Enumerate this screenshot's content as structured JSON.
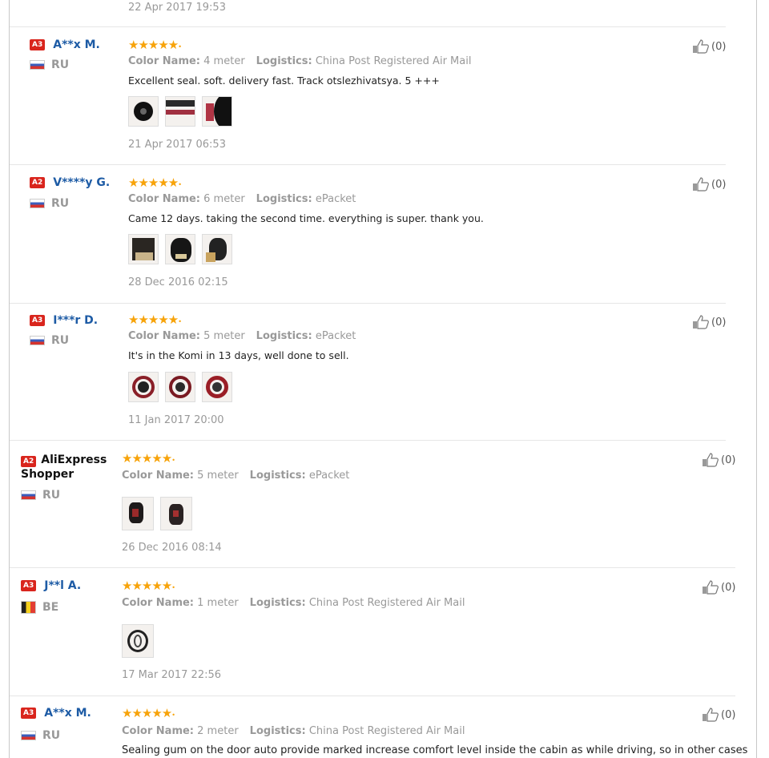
{
  "colors": {
    "username": "#1d5ba5",
    "level_badge": "#d9251d",
    "stars": "#f7a30a"
  },
  "labels": {
    "color_name": "Color Name:",
    "logistics": "Logistics:"
  },
  "top_date": "22 Apr 2017 19:53",
  "reviews": [
    {
      "level": "A3",
      "user": "A**x M.",
      "country": "RU",
      "flag": "ru",
      "stars": "★★★★★",
      "color_name": "4 meter",
      "logistics": "China Post Registered Air Mail",
      "text": "Excellent seal. soft. delivery fast. Track otslezhivatsya. 5 +++",
      "date": "21 Apr 2017 06:53",
      "helpful": "(0)",
      "photos": 3
    },
    {
      "level": "A2",
      "user": "V****y G.",
      "country": "RU",
      "flag": "ru",
      "stars": "★★★★★",
      "color_name": "6 meter",
      "logistics": "ePacket",
      "text": "Came 12 days. taking the second time. everything is super. thank you.",
      "date": "28 Dec 2016 02:15",
      "helpful": "(0)",
      "photos": 3
    },
    {
      "level": "A3",
      "user": "I***r D.",
      "country": "RU",
      "flag": "ru",
      "stars": "★★★★★",
      "color_name": "5 meter",
      "logistics": "ePacket",
      "text": "It's in the Komi in 13 days, well done to sell.",
      "date": "11 Jan 2017 20:00",
      "helpful": "(0)",
      "photos": 3
    },
    {
      "level": "A2",
      "user": "AliExpress Shopper",
      "country": "RU",
      "flag": "ru",
      "stars": "★★★★★",
      "color_name": "5 meter",
      "logistics": "ePacket",
      "text": "",
      "date": "26 Dec 2016 08:14",
      "helpful": "(0)",
      "photos": 2
    },
    {
      "level": "A3",
      "user": "J**l A.",
      "country": "BE",
      "flag": "be",
      "stars": "★★★★★",
      "color_name": "1 meter",
      "logistics": "China Post Registered Air Mail",
      "text": "",
      "date": "17 Mar 2017 22:56",
      "helpful": "(0)",
      "photos": 1
    },
    {
      "level": "A3",
      "user": "A**x M.",
      "country": "RU",
      "flag": "ru",
      "stars": "★★★★★",
      "color_name": "2 meter",
      "logistics": "China Post Registered Air Mail",
      "text": "Sealing gum on the door auto provide marked increase comfort level inside the cabin as while driving, so in other cases",
      "date": "",
      "helpful": "(0)",
      "photos": 0
    }
  ]
}
